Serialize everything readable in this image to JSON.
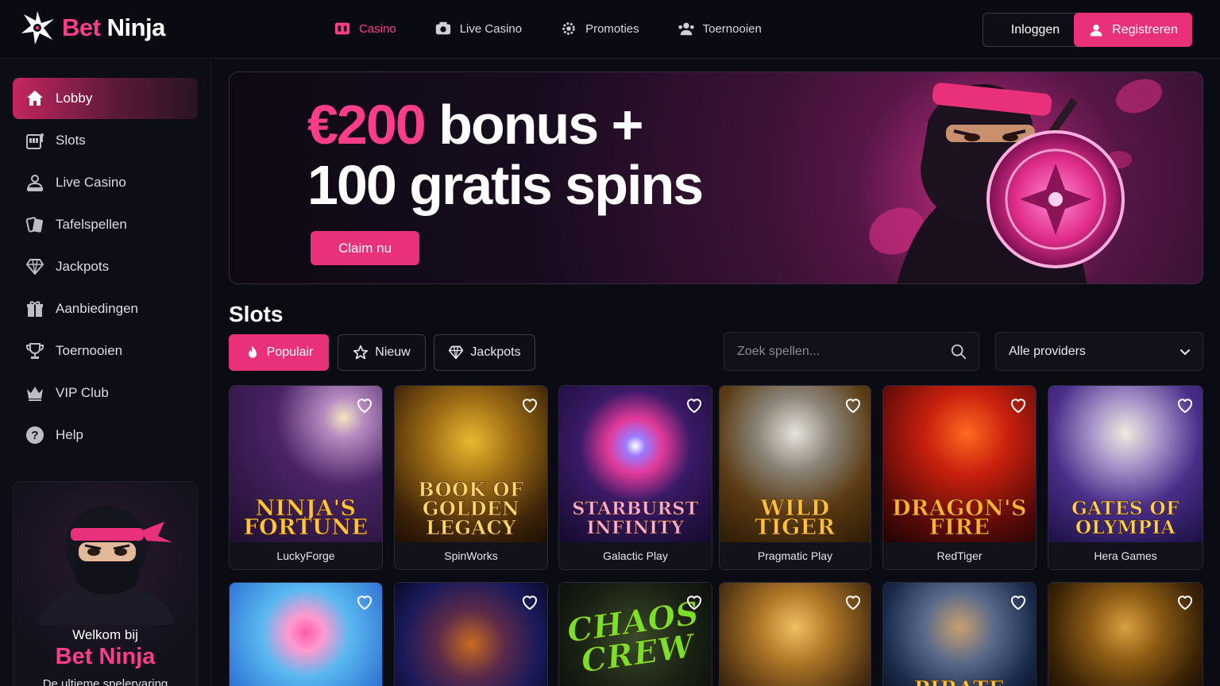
{
  "brand": {
    "bet": "Bet",
    "ninja": "Ninja"
  },
  "topnav": [
    {
      "label": "Casino",
      "icon": "casino-icon",
      "active": true
    },
    {
      "label": "Live Casino",
      "icon": "camera-icon"
    },
    {
      "label": "Promoties",
      "icon": "gear-icon"
    },
    {
      "label": "Toernooien",
      "icon": "people-icon"
    }
  ],
  "auth": {
    "login": "Inloggen",
    "register": "Registreren"
  },
  "sidebar": {
    "items": [
      {
        "label": "Lobby",
        "icon": "home-icon",
        "active": true
      },
      {
        "label": "Slots",
        "icon": "slot-machine-icon"
      },
      {
        "label": "Live Casino",
        "icon": "dealer-icon"
      },
      {
        "label": "Tafelspellen",
        "icon": "cards-icon"
      },
      {
        "label": "Jackpots",
        "icon": "diamond-icon"
      },
      {
        "label": "Aanbiedingen",
        "icon": "gift-icon"
      },
      {
        "label": "Toernooien",
        "icon": "trophy-icon"
      },
      {
        "label": "VIP Club",
        "icon": "crown-icon"
      },
      {
        "label": "Help",
        "icon": "help-icon"
      }
    ],
    "promo": {
      "welcome": "Welkom bij",
      "brand": "Bet Ninja",
      "subtitle": "De ultieme spelervaring"
    }
  },
  "banner": {
    "amount": "€200",
    "line1_rest": " bonus +",
    "line2": "100 gratis spins",
    "cta": "Claim nu"
  },
  "slots": {
    "title": "Slots",
    "filters": {
      "popular": "Populair",
      "new": "Nieuw",
      "jackpots": "Jackpots"
    },
    "search_placeholder": "Zoek spellen...",
    "provider_selected": "Alle providers",
    "games": [
      {
        "title": "Ninja's Fortune",
        "provider": "LuckyForge"
      },
      {
        "title": "Book of Golden Legacy",
        "provider": "SpinWorks"
      },
      {
        "title": "Starburst Infinity",
        "provider": "Galactic Play"
      },
      {
        "title": "Wild Tiger",
        "provider": "Pragmatic Play"
      },
      {
        "title": "Dragon's Fire",
        "provider": "RedTiger"
      },
      {
        "title": "Gates of Olympia",
        "provider": "Hera Games"
      }
    ],
    "games_row2": [
      {
        "title": ""
      },
      {
        "title": ""
      },
      {
        "title": "Chaos Crew"
      },
      {
        "title": ""
      },
      {
        "title": "Pirate"
      },
      {
        "title": ""
      }
    ]
  },
  "colors": {
    "accent": "#e8317a",
    "brand_pink": "#ff3d8b",
    "background": "#0b0b14"
  }
}
